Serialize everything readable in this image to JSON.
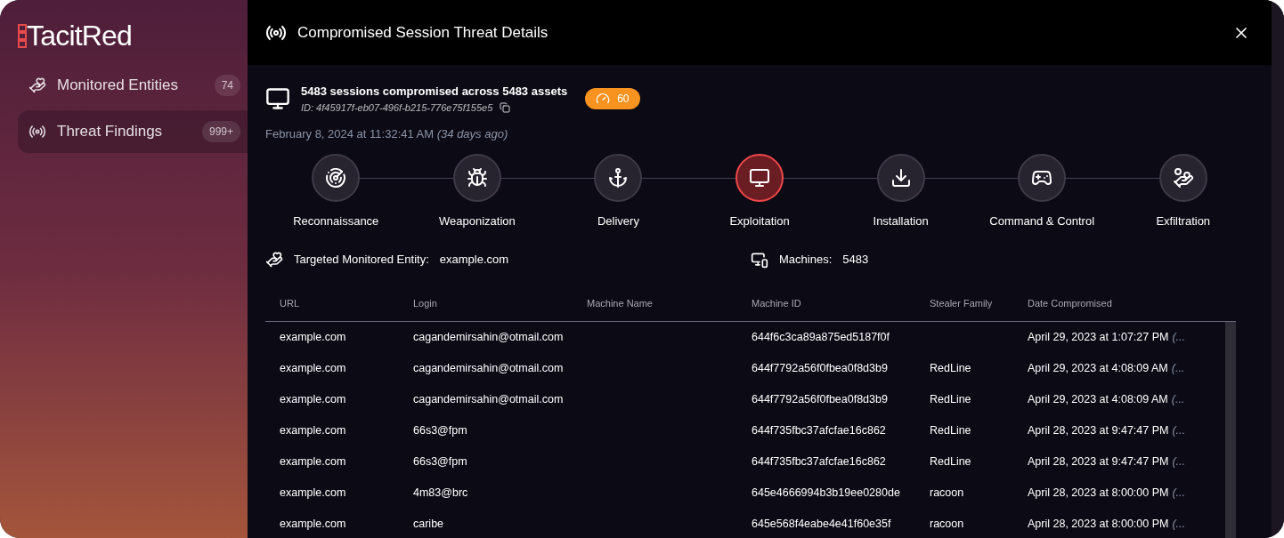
{
  "sidebar": {
    "logo": "TacitRed",
    "items": [
      {
        "label": "Monitored Entities",
        "count": "74",
        "selected": false,
        "kind": "entities"
      },
      {
        "label": "Threat Findings",
        "count": "999+",
        "selected": true,
        "kind": "threats"
      }
    ]
  },
  "dialog": {
    "title": "Compromised Session Threat Details",
    "summary": {
      "headline": "5483 sessions compromised across 5483 assets",
      "id": "ID: 4f45917f-eb07-496f-b215-776e75f155e5",
      "score": "60",
      "date": "February 8, 2024 at 11:32:41 AM",
      "relative": "(34 days ago)"
    },
    "stages": [
      {
        "label": "Reconnaissance",
        "kind": "radar",
        "selected": false
      },
      {
        "label": "Weaponization",
        "kind": "bug",
        "selected": false
      },
      {
        "label": "Delivery",
        "kind": "hook",
        "selected": false
      },
      {
        "label": "Exploitation",
        "kind": "spy",
        "selected": true
      },
      {
        "label": "Installation",
        "kind": "install",
        "selected": false
      },
      {
        "label": "Command & Control",
        "kind": "remote",
        "selected": false
      },
      {
        "label": "Exfiltration",
        "kind": "thief",
        "selected": false
      }
    ],
    "entity": {
      "label": "Targeted Monitored Entity:",
      "value": "example.com"
    },
    "machines": {
      "label": "Machines:",
      "value": "5483"
    },
    "table": {
      "columns": [
        "URL",
        "Login",
        "Machine Name",
        "Machine ID",
        "Stealer Family",
        "Date Compromised"
      ],
      "rows": [
        {
          "url": "example.com",
          "login": "cagandemirsahin@otmail.com",
          "machine_id": "644f6c3ca89a875ed5187f0f",
          "date": "April 29, 2023 at 1:07:27 PM",
          "relative": "(..."
        },
        {
          "url": "example.com",
          "login": "cagandemirsahin@otmail.com",
          "machine_id": "644f7792a56f0fbea0f8d3b9",
          "family": "RedLine",
          "date": "April 29, 2023 at 4:08:09 AM",
          "relative": "(..."
        },
        {
          "url": "example.com",
          "login": "cagandemirsahin@otmail.com",
          "machine_id": "644f7792a56f0fbea0f8d3b9",
          "family": "RedLine",
          "date": "April 29, 2023 at 4:08:09 AM",
          "relative": "(..."
        },
        {
          "url": "example.com",
          "login": "66s3@fpm",
          "machine_id": "644f735fbc37afcfae16c862",
          "family": "RedLine",
          "date": "April 28, 2023 at 9:47:47 PM",
          "relative": "(..."
        },
        {
          "url": "example.com",
          "login": "66s3@fpm",
          "machine_id": "644f735fbc37afcfae16c862",
          "family": "RedLine",
          "date": "April 28, 2023 at 9:47:47 PM",
          "relative": "(..."
        },
        {
          "url": "example.com",
          "login": "4m83@brc",
          "machine_id": "645e4666994b3b19ee0280de",
          "family": "racoon",
          "date": "April 28, 2023 at 8:00:00 PM",
          "relative": "(..."
        },
        {
          "url": "example.com",
          "login": "caribe",
          "machine_id": "645e568f4eabe4e41f60e35f",
          "family": "racoon",
          "date": "April 28, 2023 at 8:00:00 PM",
          "relative": "(..."
        }
      ]
    }
  }
}
